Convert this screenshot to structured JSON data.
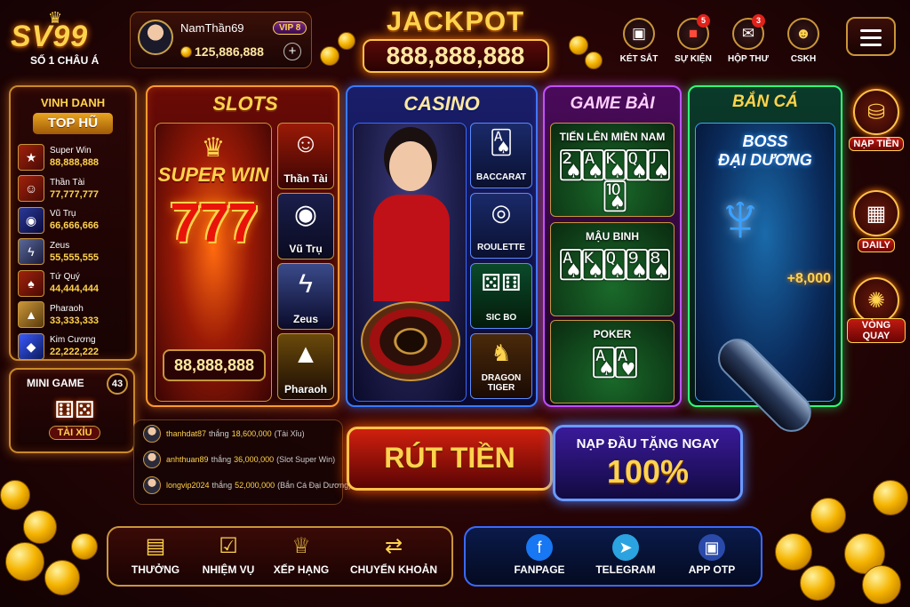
{
  "brand": {
    "logo": "SV99",
    "tagline": "SỐ 1 CHÂU Á"
  },
  "user": {
    "name": "NamThần69",
    "vip": "VIP 8",
    "balance": "125,886,888",
    "add_label": "+"
  },
  "jackpot": {
    "title": "JACKPOT",
    "value": "888,888,888"
  },
  "top_nav": [
    {
      "label": "KÉT SẮT",
      "icon": "safe-icon",
      "badge": ""
    },
    {
      "label": "SỰ KIỆN",
      "icon": "gift-icon",
      "badge": "5"
    },
    {
      "label": "HỘP THƯ",
      "icon": "mail-icon",
      "badge": "3"
    },
    {
      "label": "CSKH",
      "icon": "support-icon",
      "badge": ""
    }
  ],
  "ranking": {
    "heading": "VINH DANH",
    "subheading": "TOP HŨ",
    "items": [
      {
        "name": "Super Win",
        "value": "88,888,888"
      },
      {
        "name": "Thần Tài",
        "value": "77,777,777"
      },
      {
        "name": "Vũ Trụ",
        "value": "66,666,666"
      },
      {
        "name": "Zeus",
        "value": "55,555,555"
      },
      {
        "name": "Tứ Quý",
        "value": "44,444,444"
      },
      {
        "name": "Pharaoh",
        "value": "33,333,333"
      },
      {
        "name": "Kim Cương",
        "value": "22,222,222"
      }
    ]
  },
  "minigame": {
    "title": "MINI GAME",
    "count": "43",
    "game": "TÀI XỈU"
  },
  "slots": {
    "title": "SLOTS",
    "feature_label": "SUPER WIN",
    "feature_number": "777",
    "jackpot": "88,888,888",
    "games": [
      "Thần Tài",
      "Vũ Trụ",
      "Zeus",
      "Pharaoh"
    ]
  },
  "casino": {
    "title": "CASINO",
    "games": [
      "BACCARAT",
      "ROULETTE",
      "SIC BO",
      "DRAGON TIGER"
    ]
  },
  "gamebai": {
    "title": "GAME BÀI",
    "games": [
      "TIẾN LÊN MIỀN NAM",
      "MẬU BINH",
      "POKER"
    ]
  },
  "banca": {
    "title": "BẮN CÁ",
    "boss_line1": "BOSS",
    "boss_line2": "ĐẠI DƯƠNG",
    "bonus": "+8,000"
  },
  "side_buttons": [
    {
      "label": "NẠP TIỀN",
      "icon": "coin-stack-icon"
    },
    {
      "label": "DAILY",
      "icon": "calendar-icon"
    },
    {
      "label": "VÒNG QUAY",
      "icon": "wheel-icon"
    }
  ],
  "winners": [
    {
      "user": "thanhdat87",
      "word": "thắng",
      "amount": "18,600,000",
      "game": "(Tài Xỉu)"
    },
    {
      "user": "anhthuan89",
      "word": "thắng",
      "amount": "36,000,000",
      "game": "(Slot Super Win)"
    },
    {
      "user": "longvip2024",
      "word": "thắng",
      "amount": "52,000,000",
      "game": "(Bắn Cá Đại Dương)"
    }
  ],
  "withdraw": {
    "label": "RÚT TIỀN"
  },
  "deposit_promo": {
    "line1": "NẠP ĐẦU TẶNG NGAY",
    "line2": "100%"
  },
  "bottom_left": [
    {
      "label": "THƯỞNG",
      "icon": "gift-icon"
    },
    {
      "label": "NHIỆM VỤ",
      "icon": "checklist-icon"
    },
    {
      "label": "XẾP HẠNG",
      "icon": "trophy-icon"
    },
    {
      "label": "CHUYỂN KHOẢN",
      "icon": "transfer-icon"
    }
  ],
  "bottom_right": [
    {
      "label": "FANPAGE",
      "icon": "facebook-icon"
    },
    {
      "label": "TELEGRAM",
      "icon": "telegram-icon"
    },
    {
      "label": "APP OTP",
      "icon": "lock-icon"
    }
  ],
  "colors": {
    "gold": "#ffd34d",
    "red_panel": "#6a0a06",
    "casino_blue": "#1a1e6a",
    "gamebai_purple": "#4a0a5a",
    "banca_green": "#0a3a2a"
  }
}
